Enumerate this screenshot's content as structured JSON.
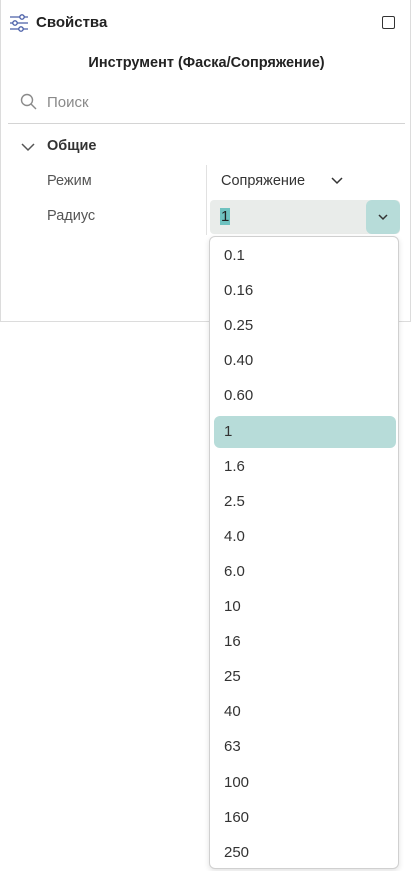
{
  "panel": {
    "title": "Свойства",
    "subtitle": "Инструмент (Фаска/Сопряжение)",
    "search": {
      "placeholder": "Поиск",
      "value": ""
    },
    "group": {
      "label": "Общие",
      "expanded": true
    },
    "properties": {
      "mode": {
        "label": "Режим",
        "value": "Сопряжение"
      },
      "radius": {
        "label": "Радиус",
        "value": "1"
      }
    }
  },
  "dropdown": {
    "options": [
      "0.1",
      "0.16",
      "0.25",
      "0.40",
      "0.60",
      "1",
      "1.6",
      "2.5",
      "4.0",
      "6.0",
      "10",
      "16",
      "25",
      "40",
      "63",
      "100",
      "160",
      "250"
    ],
    "selected_index": 5
  },
  "colors": {
    "accent_light": "#b7dcd9",
    "text_highlight": "#6fc2c0",
    "icon_blue": "#4a5fa8"
  },
  "icons": {
    "header": "settings-sliders-icon",
    "maximize": "maximize-icon",
    "search": "search-icon",
    "group": "chevron-down-icon",
    "dropdown": "chevron-down-icon"
  }
}
